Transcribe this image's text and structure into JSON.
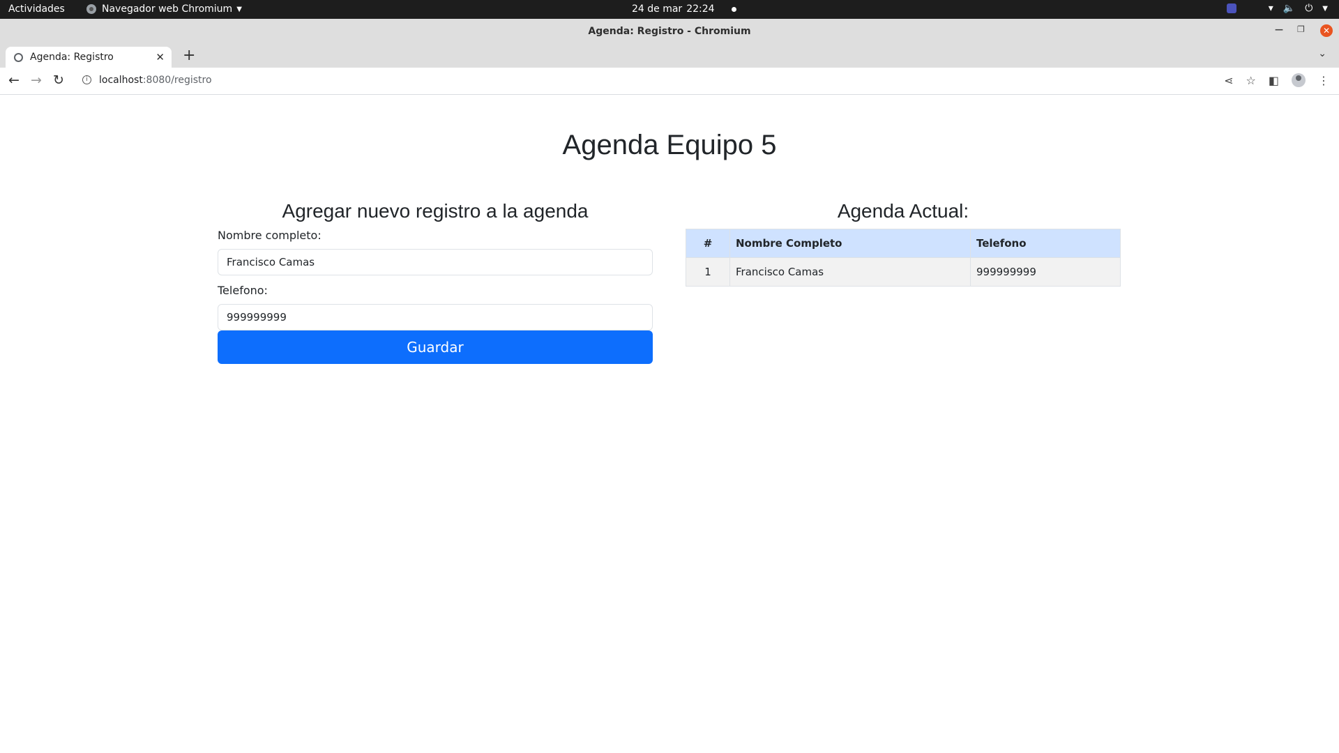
{
  "system": {
    "activities": "Actividades",
    "app_menu": "Navegador web Chromium",
    "date": "24 de mar",
    "time": "22:24"
  },
  "window": {
    "title": "Agenda: Registro - Chromium"
  },
  "browser": {
    "tab_title": "Agenda: Registro",
    "url_host": "localhost",
    "url_rest": ":8080/registro"
  },
  "page": {
    "title": "Agenda Equipo 5",
    "form": {
      "heading": "Agregar nuevo registro a la agenda",
      "name_label": "Nombre completo:",
      "name_value": "Francisco Camas",
      "phone_label": "Telefono:",
      "phone_value": "999999999",
      "save_label": "Guardar"
    },
    "agenda": {
      "heading": "Agenda Actual:",
      "columns": [
        "#",
        "Nombre Completo",
        "Telefono"
      ],
      "rows": [
        [
          "1",
          "Francisco Camas",
          "999999999"
        ]
      ]
    }
  },
  "colors": {
    "primary": "#0d6efd",
    "table_header": "#cfe2ff",
    "row_bg": "#f2f2f2",
    "close_button": "#e95420"
  }
}
